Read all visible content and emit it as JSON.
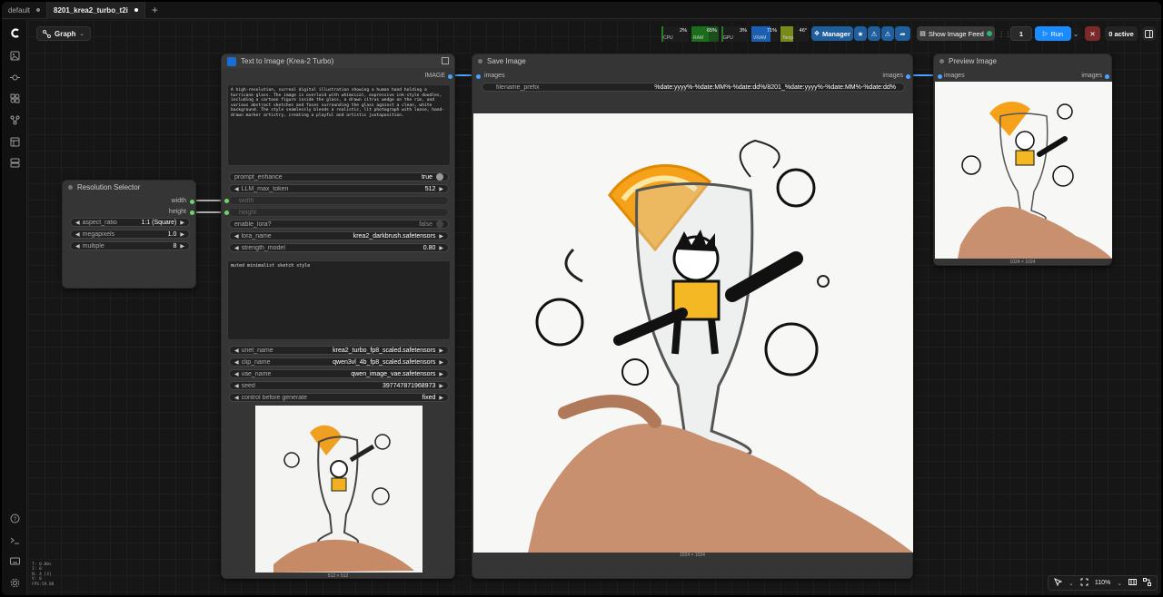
{
  "tabs": [
    {
      "label": "default",
      "active": false
    },
    {
      "label": "8201_krea2_turbo_t2i",
      "active": true
    }
  ],
  "toolbar": {
    "graph_label": "Graph",
    "stats": [
      {
        "label": "CPU",
        "value": "2%"
      },
      {
        "label": "RAM",
        "value": "65%"
      },
      {
        "label": "GPU",
        "value": "3%"
      },
      {
        "label": "VRAM",
        "value": "71%"
      },
      {
        "label": "Temp",
        "value": "46°"
      }
    ],
    "manager_label": "Manager",
    "image_feed_label": "Show Image Feed",
    "queue_count": "1",
    "run_label": "Run",
    "active_label": "0 active"
  },
  "nodes": {
    "resolution": {
      "title": "Resolution Selector",
      "outputs": [
        "width",
        "height"
      ],
      "widgets": [
        {
          "name": "aspect_ratio",
          "value": "1:1 (Square)"
        },
        {
          "name": "megapixels",
          "value": "1.0"
        },
        {
          "name": "multiple",
          "value": "8"
        }
      ]
    },
    "t2i": {
      "title": "Text to Image (Krea-2 Turbo)",
      "output": "IMAGE",
      "prompt": "A high-resolution, surreal digital illustration showing a human hand holding a hurricane glass. The image is overlaid with whimsical, expressive ink-style doodles, including a cartoon figure inside the glass, a drawn citrus wedge on the rim, and various abstract sketches and faces surrounding the glass against a clean, white background. The style seamlessly blends a realistic, lit photograph with loose, hand-drawn marker artistry, creating a playful and artistic juxtaposition.",
      "widgets1": [
        {
          "name": "prompt_enhance",
          "value": "true",
          "type": "toggle"
        },
        {
          "name": "LLM_max_token",
          "value": "512",
          "type": "number"
        },
        {
          "name": "width",
          "value": "",
          "type": "disabled"
        },
        {
          "name": "height",
          "value": "",
          "type": "disabled"
        },
        {
          "name": "enable_lora?",
          "value": "false",
          "type": "toggle-off"
        },
        {
          "name": "lora_name",
          "value": "krea2_darkbrush.safetensors",
          "type": "combo"
        },
        {
          "name": "strength_model",
          "value": "0.80",
          "type": "number"
        }
      ],
      "lora_prompt": "muted minimalist sketch style",
      "widgets2": [
        {
          "name": "unet_name",
          "value": "krea2_turbo_fp8_scaled.safetensors"
        },
        {
          "name": "clip_name",
          "value": "qwen3vl_4b_fp8_scaled.safetensors"
        },
        {
          "name": "vae_name",
          "value": "qwen_image_vae.safetensors"
        },
        {
          "name": "seed",
          "value": "397747871968973"
        },
        {
          "name": "control before generate",
          "value": "fixed"
        }
      ],
      "image_size": "512 × 512"
    },
    "save": {
      "title": "Save Image",
      "input": "images",
      "output": "images",
      "filename_label": "filename_prefix",
      "filename_value": "%date:yyyy%-%date:MM%-%date:dd%/8201_%date:yyyy%-%date:MM%-%date:dd%",
      "image_size": "1024 × 1024"
    },
    "preview": {
      "title": "Preview Image",
      "input": "images",
      "output": "images",
      "image_size": "1024 × 1024"
    }
  },
  "status": [
    "T: 0.00s",
    "I: 0",
    "N: 4 [4]",
    "V: 0",
    "FPS:59.88"
  ],
  "zoom": {
    "level": "110%"
  },
  "colors": {
    "accent": "#1a8cff",
    "link_green": "#6fd36f",
    "link_blue": "#4aa3ff",
    "cancel": "#7a2a2a"
  }
}
